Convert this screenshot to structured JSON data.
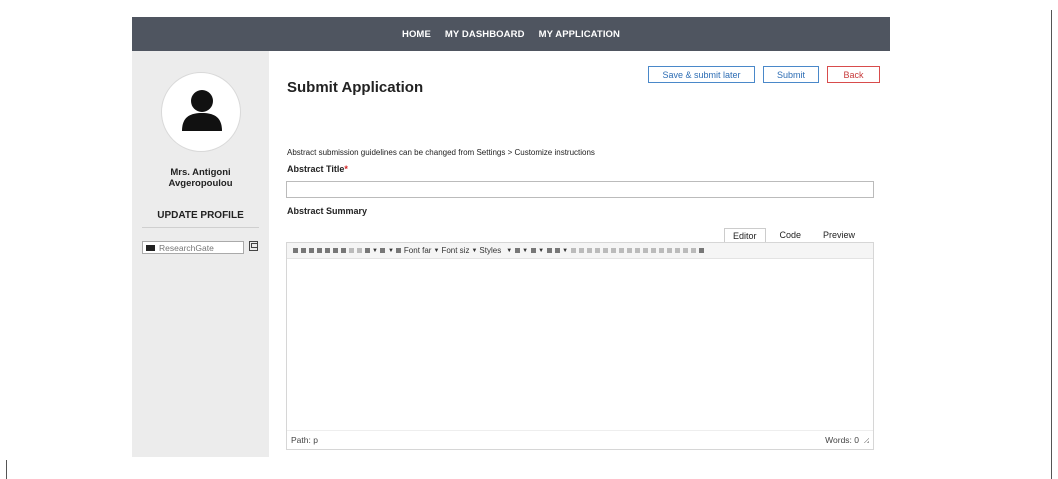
{
  "nav": {
    "items": [
      {
        "label": "HOME"
      },
      {
        "label": "MY DASHBOARD"
      },
      {
        "label": "MY APPLICATION"
      }
    ]
  },
  "sidebar": {
    "user_name_line1": "Mrs. Antigoni",
    "user_name_line2": "Avgeropoulou",
    "update_profile": "UPDATE PROFILE",
    "researchgate_placeholder": "ResearchGate"
  },
  "main": {
    "title": "Submit Application",
    "buttons": {
      "save_later": "Save & submit later",
      "submit": "Submit",
      "back": "Back"
    },
    "guideline": "Abstract submission guidelines can be changed from Settings > Customize instructions",
    "abstract_title_label": "Abstract Title",
    "required_mark": "*",
    "abstract_title_value": "",
    "abstract_summary_label": "Abstract Summary",
    "editor": {
      "tabs": [
        {
          "label": "Editor",
          "active": true
        },
        {
          "label": "Code",
          "active": false
        },
        {
          "label": "Preview",
          "active": false
        }
      ],
      "toolbar_font_family": "Font far",
      "toolbar_font_size": "Font siz",
      "toolbar_styles": "Styles",
      "path": "Path: p",
      "word_count": "Words: 0"
    }
  },
  "colors": {
    "nav_bg": "#4f5560",
    "sidebar_bg": "#ececec",
    "primary": "#2d6db4",
    "danger": "#c73a3a",
    "required": "#d32020"
  }
}
